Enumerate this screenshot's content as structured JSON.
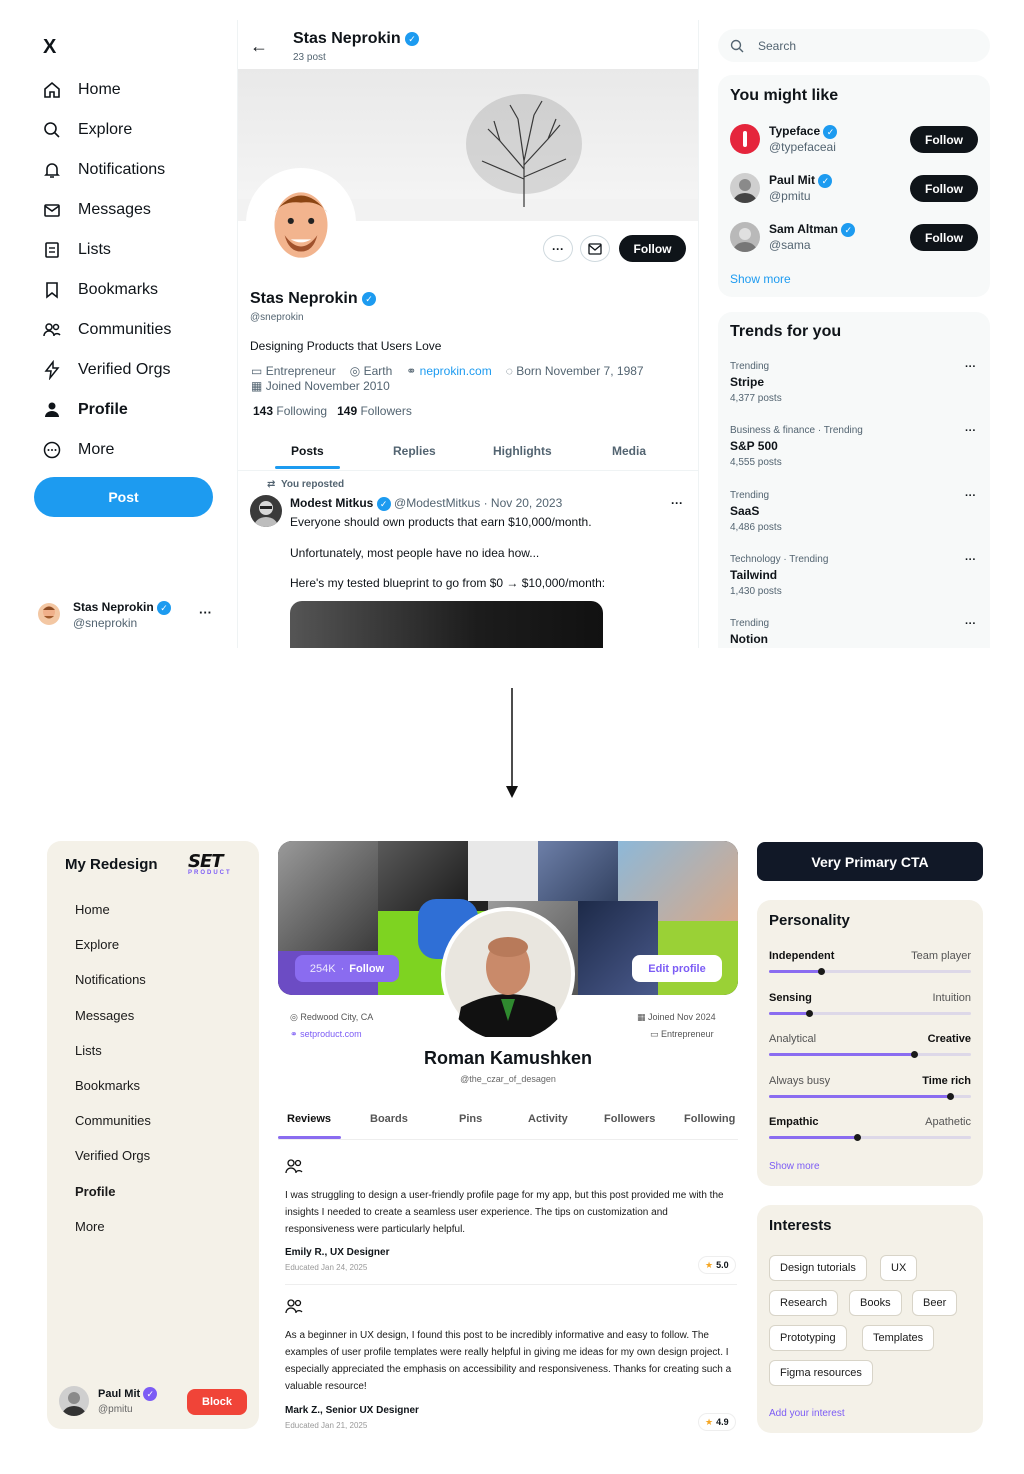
{
  "top": {
    "sidebar": {
      "logo": "X",
      "items": [
        {
          "label": "Home",
          "icon": "home-icon"
        },
        {
          "label": "Explore",
          "icon": "search-icon"
        },
        {
          "label": "Notifications",
          "icon": "bell-icon"
        },
        {
          "label": "Messages",
          "icon": "mail-icon"
        },
        {
          "label": "Lists",
          "icon": "list-icon"
        },
        {
          "label": "Bookmarks",
          "icon": "bookmark-icon"
        },
        {
          "label": "Communities",
          "icon": "people-icon"
        },
        {
          "label": "Verified Orgs",
          "icon": "bolt-icon"
        },
        {
          "label": "Profile",
          "icon": "person-icon"
        },
        {
          "label": "More",
          "icon": "more-circle-icon"
        }
      ],
      "post_button": "Post",
      "account": {
        "name": "Stas Neprokin",
        "handle": "@sneprokin"
      }
    },
    "header": {
      "name": "Stas Neprokin",
      "post_count": "23 post"
    },
    "profile": {
      "name": "Stas Neprokin",
      "handle": "@sneprokin",
      "bio": "Designing Products that Users Love",
      "category": "Entrepreneur",
      "location": "Earth",
      "website": "neprokin.com",
      "birthday": "Born November 7, 1987",
      "joined": "Joined November 2010",
      "following_count": "143",
      "following_label": "Following",
      "followers_count": "149",
      "followers_label": "Followers",
      "follow_button": "Follow",
      "more_button": "···"
    },
    "tabs": [
      "Posts",
      "Replies",
      "Highlights",
      "Media"
    ],
    "post": {
      "repost_label": "You reposted",
      "author": "Modest Mitkus",
      "handle_date": "@ModestMitkus · Nov 20, 2023",
      "line1": "Everyone should own products that earn $10,000/month.",
      "line2": "Unfortunately, most people have no idea how...",
      "line3": "Here's my tested blueprint to go from $0 → $10,000/month:",
      "more": "···"
    },
    "search_placeholder": "Search",
    "suggestions": {
      "title": "You might like",
      "accounts": [
        {
          "name": "Typeface",
          "handle": "@typefaceai",
          "button": "Follow"
        },
        {
          "name": "Paul Mit",
          "handle": "@pmitu",
          "button": "Follow"
        },
        {
          "name": "Sam Altman",
          "handle": "@sama",
          "button": "Follow"
        }
      ],
      "show_more": "Show more"
    },
    "trends": {
      "title": "Trends for you",
      "items": [
        {
          "category": "Trending",
          "name": "Stripe",
          "posts": "4,377 posts"
        },
        {
          "category": "Business & finance · Trending",
          "name": "S&P 500",
          "posts": "4,555 posts"
        },
        {
          "category": "Trending",
          "name": "SaaS",
          "posts": "4,486 posts"
        },
        {
          "category": "Technology · Trending",
          "name": "Tailwind",
          "posts": "1,430 posts"
        },
        {
          "category": "Trending",
          "name": "Notion",
          "posts": ""
        }
      ],
      "more": "···"
    }
  },
  "bottom": {
    "sidebar": {
      "title": "My Redesign",
      "logo_text": "SET",
      "logo_sub": "PRODUCT",
      "items": [
        "Home",
        "Explore",
        "Notifications",
        "Messages",
        "Lists",
        "Bookmarks",
        "Communities",
        "Verified Orgs",
        "Profile",
        "More"
      ],
      "account": {
        "name": "Paul Mit",
        "handle": "@pmitu"
      },
      "block_button": "Block"
    },
    "profile": {
      "followers_pill": "254K",
      "follow_label": "Follow",
      "edit_button": "Edit profile",
      "location": "Redwood City, CA",
      "website": "setproduct.com",
      "joined": "Joined Nov 2024",
      "category": "Entrepreneur",
      "name": "Roman Kamushken",
      "handle": "@the_czar_of_desagen"
    },
    "tabs": [
      "Reviews",
      "Boards",
      "Pins",
      "Activity",
      "Followers",
      "Following"
    ],
    "reviews": [
      {
        "text": "I was struggling to design a user-friendly profile page for my app, but this post provided me with the insights I needed to create a seamless user experience. The tips on customization and responsiveness were particularly helpful.",
        "author": "Emily R., UX Designer",
        "date": "Educated Jan 24, 2025",
        "rating": "5.0"
      },
      {
        "text": "As a beginner in UX design, I found this post to be incredibly informative and easy to follow. The examples of user profile templates were really helpful in giving me ideas for my own design project. I especially appreciated the emphasis on accessibility and responsiveness. Thanks for creating such a valuable resource!",
        "author": "Mark Z., Senior UX Designer",
        "date": "Educated Jan 21, 2025",
        "rating": "4.9"
      }
    ],
    "cta": "Very Primary CTA",
    "personality": {
      "title": "Personality",
      "traits": [
        {
          "left": "Independent",
          "right": "Team player",
          "bold": "left",
          "level": 0.26
        },
        {
          "left": "Sensing",
          "right": "Intuition",
          "bold": "left",
          "level": 0.2
        },
        {
          "left": "Analytical",
          "right": "Creative",
          "bold": "right",
          "level": 0.72
        },
        {
          "left": "Always busy",
          "right": "Time rich",
          "bold": "right",
          "level": 0.9
        },
        {
          "left": "Empathic",
          "right": "Apathetic",
          "bold": "left",
          "level": 0.44
        }
      ],
      "show_more": "Show more"
    },
    "interests": {
      "title": "Interests",
      "chips": [
        "Design tutorials",
        "UX",
        "Research",
        "Books",
        "Beer",
        "Prototyping",
        "Templates",
        "Figma resources"
      ],
      "add": "Add your interest"
    }
  },
  "colors": {
    "x_blue": "#1d9bf0",
    "purple": "#8a6cf0",
    "beige": "#f4f1e8",
    "block_red": "#f04438",
    "black": "#0f1419"
  }
}
